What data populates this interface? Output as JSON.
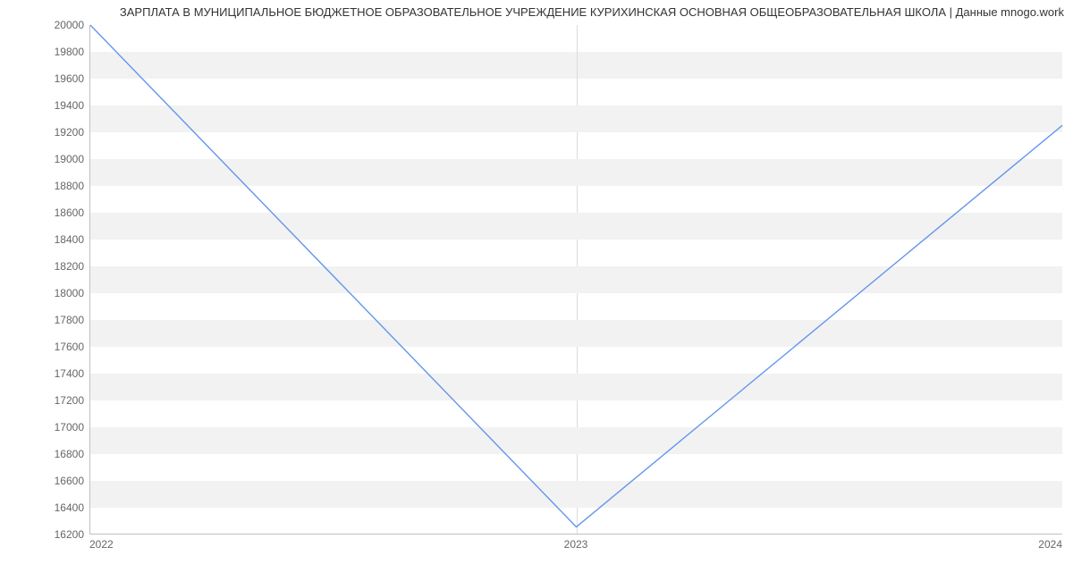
{
  "chart_data": {
    "type": "line",
    "title": "ЗАРПЛАТА В МУНИЦИПАЛЬНОЕ БЮДЖЕТНОЕ ОБРАЗОВАТЕЛЬНОЕ УЧРЕЖДЕНИЕ КУРИХИНСКАЯ ОСНОВНАЯ ОБЩЕОБРАЗОВАТЕЛЬНАЯ ШКОЛА | Данные mnogo.work",
    "xlabel": "",
    "ylabel": "",
    "x_categories": [
      "2022",
      "2023",
      "2024"
    ],
    "y_ticks": [
      16200,
      16400,
      16600,
      16800,
      17000,
      17200,
      17400,
      17600,
      17800,
      18000,
      18200,
      18400,
      18600,
      18800,
      19000,
      19200,
      19400,
      19600,
      19800,
      20000
    ],
    "ylim": [
      16200,
      20000
    ],
    "series": [
      {
        "name": "salary",
        "x": [
          "2022",
          "2023",
          "2024"
        ],
        "values": [
          20000,
          16250,
          19250
        ]
      }
    ],
    "colors": {
      "line": "#6495ed",
      "band": "#f2f2f2",
      "axis": "#c0c0c0",
      "text": "#666666"
    }
  }
}
